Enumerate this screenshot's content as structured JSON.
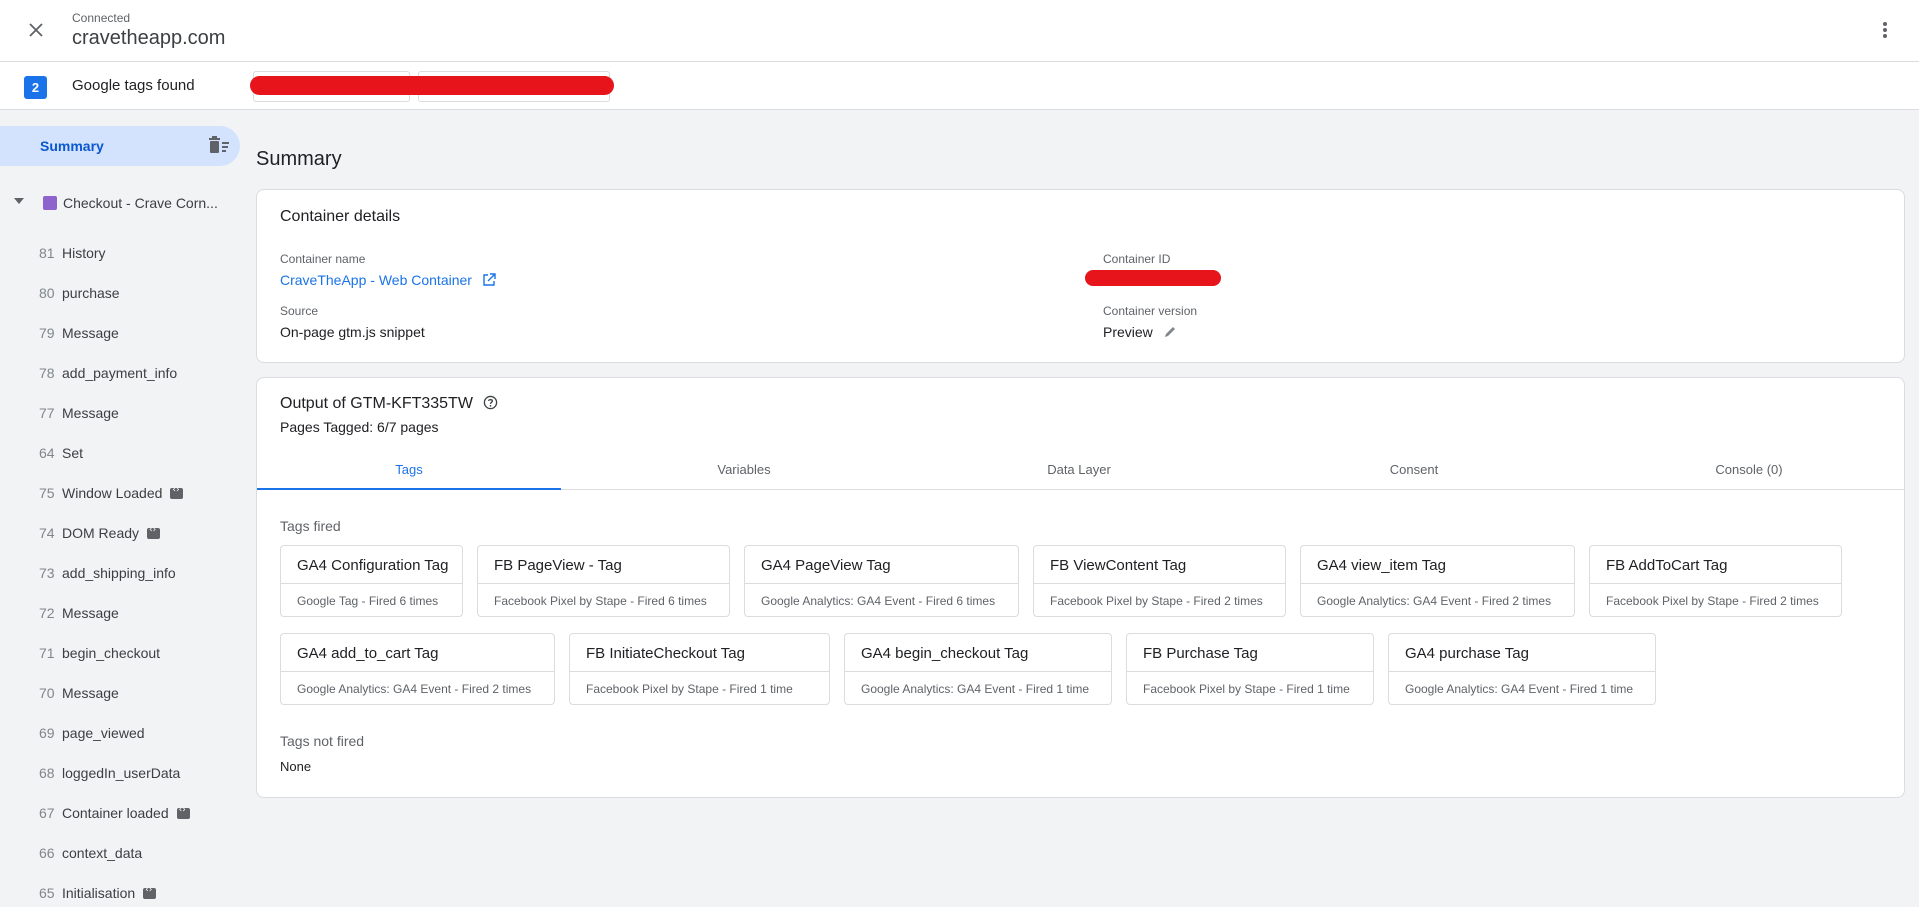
{
  "header": {
    "status": "Connected",
    "domain": "cravetheapp.com"
  },
  "tags_bar": {
    "count": "2",
    "label": "Google tags found"
  },
  "sidebar": {
    "summary_label": "Summary",
    "page_label": "Checkout - Crave Corn...",
    "events": [
      {
        "num": "81",
        "name": "History",
        "icon": false
      },
      {
        "num": "80",
        "name": "purchase",
        "icon": false
      },
      {
        "num": "79",
        "name": "Message",
        "icon": false
      },
      {
        "num": "78",
        "name": "add_payment_info",
        "icon": false
      },
      {
        "num": "77",
        "name": "Message",
        "icon": false
      },
      {
        "num": "64",
        "name": "Set",
        "icon": false
      },
      {
        "num": "75",
        "name": "Window Loaded",
        "icon": true
      },
      {
        "num": "74",
        "name": "DOM Ready",
        "icon": true
      },
      {
        "num": "73",
        "name": "add_shipping_info",
        "icon": false
      },
      {
        "num": "72",
        "name": "Message",
        "icon": false
      },
      {
        "num": "71",
        "name": "begin_checkout",
        "icon": false
      },
      {
        "num": "70",
        "name": "Message",
        "icon": false
      },
      {
        "num": "69",
        "name": "page_viewed",
        "icon": false
      },
      {
        "num": "68",
        "name": "loggedIn_userData",
        "icon": false
      },
      {
        "num": "67",
        "name": "Container loaded",
        "icon": true
      },
      {
        "num": "66",
        "name": "context_data",
        "icon": false
      },
      {
        "num": "65",
        "name": "Initialisation",
        "icon": true
      }
    ]
  },
  "main": {
    "title": "Summary",
    "container_details": {
      "title": "Container details",
      "name_label": "Container name",
      "name_value": "CraveTheApp - Web Container",
      "id_label": "Container ID",
      "source_label": "Source",
      "source_value": "On-page gtm.js snippet",
      "version_label": "Container version",
      "version_value": "Preview"
    },
    "output": {
      "title": "Output of GTM-KFT335TW",
      "pages_tagged": "Pages Tagged: 6/7 pages",
      "tabs": [
        "Tags",
        "Variables",
        "Data Layer",
        "Consent",
        "Console (0)"
      ],
      "tags_fired_label": "Tags fired",
      "tags_fired": [
        {
          "name": "GA4 Configuration Tag",
          "desc": "Google Tag - Fired 6 times"
        },
        {
          "name": "FB PageView - Tag",
          "desc": "Facebook Pixel by Stape - Fired 6 times"
        },
        {
          "name": "GA4 PageView Tag",
          "desc": "Google Analytics: GA4 Event - Fired 6 times"
        },
        {
          "name": "FB ViewContent Tag",
          "desc": "Facebook Pixel by Stape - Fired 2 times"
        },
        {
          "name": "GA4 view_item Tag",
          "desc": "Google Analytics: GA4 Event - Fired 2 times"
        },
        {
          "name": "FB AddToCart Tag",
          "desc": "Facebook Pixel by Stape - Fired 2 times"
        },
        {
          "name": "GA4 add_to_cart Tag",
          "desc": "Google Analytics: GA4 Event - Fired 2 times"
        },
        {
          "name": "FB InitiateCheckout Tag",
          "desc": "Facebook Pixel by Stape - Fired 1 time"
        },
        {
          "name": "GA4 begin_checkout Tag",
          "desc": "Google Analytics: GA4 Event - Fired 1 time"
        },
        {
          "name": "FB Purchase Tag",
          "desc": "Facebook Pixel by Stape - Fired 1 time"
        },
        {
          "name": "GA4 purchase Tag",
          "desc": "Google Analytics: GA4 Event - Fired 1 time"
        }
      ],
      "tags_not_fired_label": "Tags not fired",
      "tags_not_fired_value": "None"
    }
  }
}
